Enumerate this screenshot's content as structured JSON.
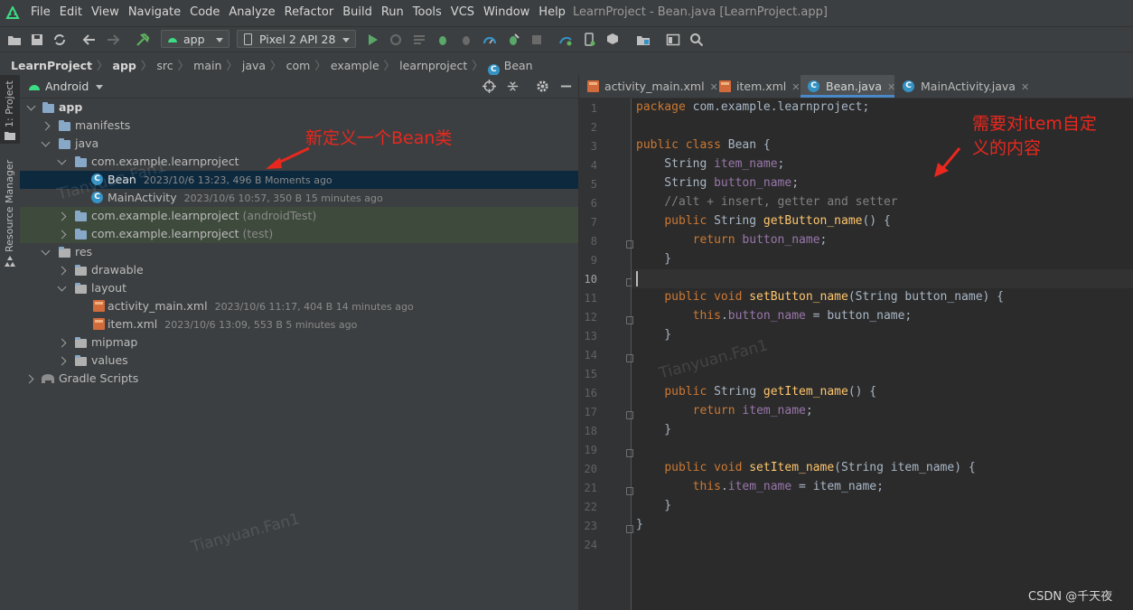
{
  "menu": {
    "items": [
      "File",
      "Edit",
      "View",
      "Navigate",
      "Code",
      "Analyze",
      "Refactor",
      "Build",
      "Run",
      "Tools",
      "VCS",
      "Window",
      "Help"
    ],
    "window_title": "LearnProject - Bean.java [LearnProject.app]"
  },
  "toolbar": {
    "module_combo": "app",
    "device_combo": "Pixel 2 API 28"
  },
  "breadcrumb": [
    "LearnProject",
    "app",
    "src",
    "main",
    "java",
    "com",
    "example",
    "learnproject",
    "Bean"
  ],
  "sidebar_left": {
    "project_tab": "1: Project",
    "resource_tab": "Resource Manager"
  },
  "project": {
    "view_selector": "Android",
    "tree": [
      {
        "label": "app",
        "meta": ""
      },
      {
        "label": "manifests",
        "meta": ""
      },
      {
        "label": "java",
        "meta": ""
      },
      {
        "label": "com.example.learnproject",
        "meta": ""
      },
      {
        "label": "Bean",
        "meta": "2023/10/6 13:23, 496 B  Moments ago"
      },
      {
        "label": "MainActivity",
        "meta": "2023/10/6 10:57, 350 B  15 minutes ago"
      },
      {
        "label": "com.example.learnproject",
        "meta": "(androidTest)"
      },
      {
        "label": "com.example.learnproject",
        "meta": "(test)"
      },
      {
        "label": "res",
        "meta": ""
      },
      {
        "label": "drawable",
        "meta": ""
      },
      {
        "label": "layout",
        "meta": ""
      },
      {
        "label": "activity_main.xml",
        "meta": "2023/10/6 11:17, 404 B  14 minutes ago"
      },
      {
        "label": "item.xml",
        "meta": "2023/10/6 13:09, 553 B  5 minutes ago"
      },
      {
        "label": "mipmap",
        "meta": ""
      },
      {
        "label": "values",
        "meta": ""
      },
      {
        "label": "Gradle Scripts",
        "meta": ""
      }
    ]
  },
  "editor": {
    "tabs": [
      {
        "label": "activity_main.xml",
        "active": false
      },
      {
        "label": "item.xml",
        "active": false
      },
      {
        "label": "Bean.java",
        "active": true
      },
      {
        "label": "MainActivity.java",
        "active": false
      }
    ],
    "line_numbers": [
      "1",
      "2",
      "3",
      "4",
      "5",
      "6",
      "7",
      "8",
      "9",
      "10",
      "11",
      "12",
      "13",
      "14",
      "15",
      "16",
      "17",
      "18",
      "19",
      "20",
      "21",
      "22",
      "23",
      "24"
    ]
  },
  "annotations": {
    "left": "新定义一个Bean类",
    "right_line1": "需要对item自定",
    "right_line2": "义的内容"
  },
  "watermarks": [
    "Tianyuan.Fan1",
    "Tianyuan.Fan1",
    "Tianyuan.Fan1"
  ],
  "footer_credit": "CSDN @千天夜",
  "colors": {
    "ide_bg": "#2b2b2b",
    "panel_bg": "#3c3f41",
    "selection": "#0d293e",
    "test_row_bg": "#3e4a3c",
    "annotation_red": "#e8281e",
    "keyword": "#cc7832",
    "field": "#9876aa",
    "method": "#ffc66d"
  }
}
